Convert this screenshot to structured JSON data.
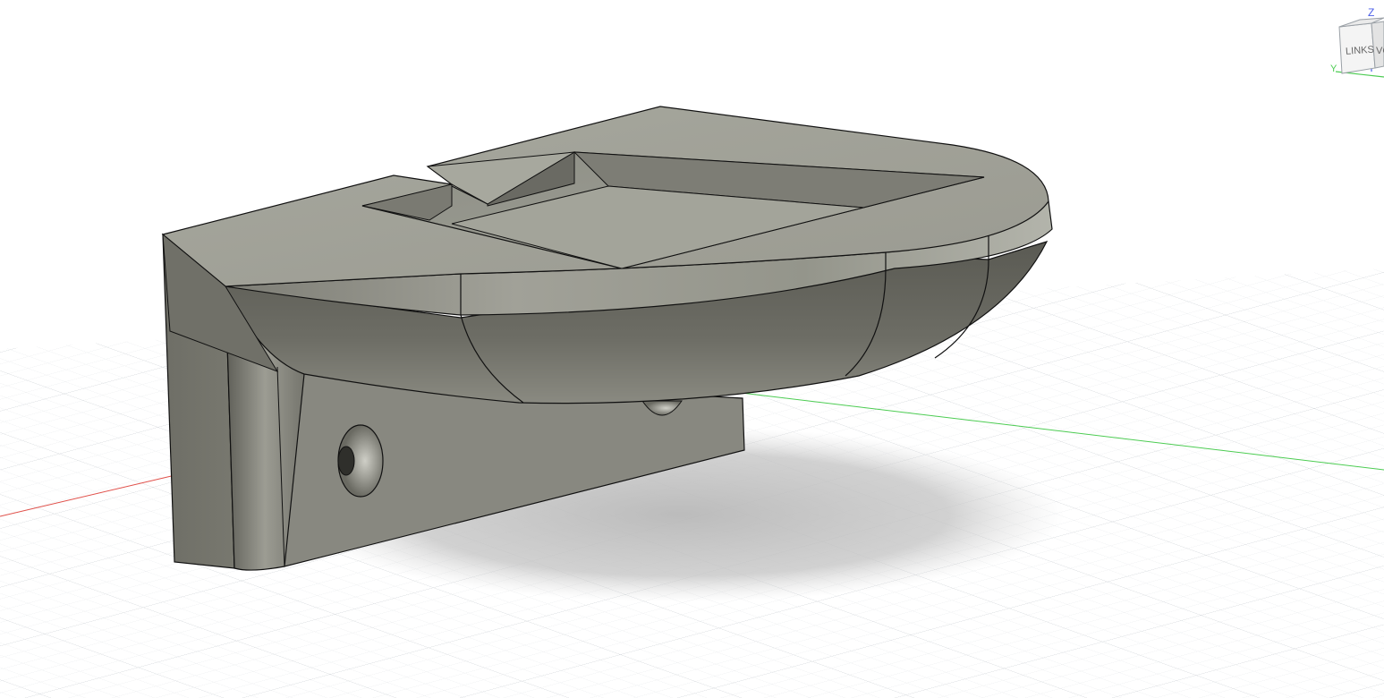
{
  "viewcube": {
    "face_left": "LINKS",
    "face_front": "VO",
    "axis_z": "Z",
    "axis_y": "Y"
  },
  "colors": {
    "background": "#ffffff",
    "grid_minor": "#ebedef",
    "grid_major": "#c9cdd2",
    "x_axis": "#e0504a",
    "y_axis": "#4ccc52",
    "z_axis": "#4a5ee8",
    "body_light": "#a9a99f",
    "body_mid": "#8d8d84",
    "body_dark": "#5f5f57",
    "edge": "#111111"
  },
  "icons": [
    "viewcube-icon",
    "home-view-icon"
  ]
}
